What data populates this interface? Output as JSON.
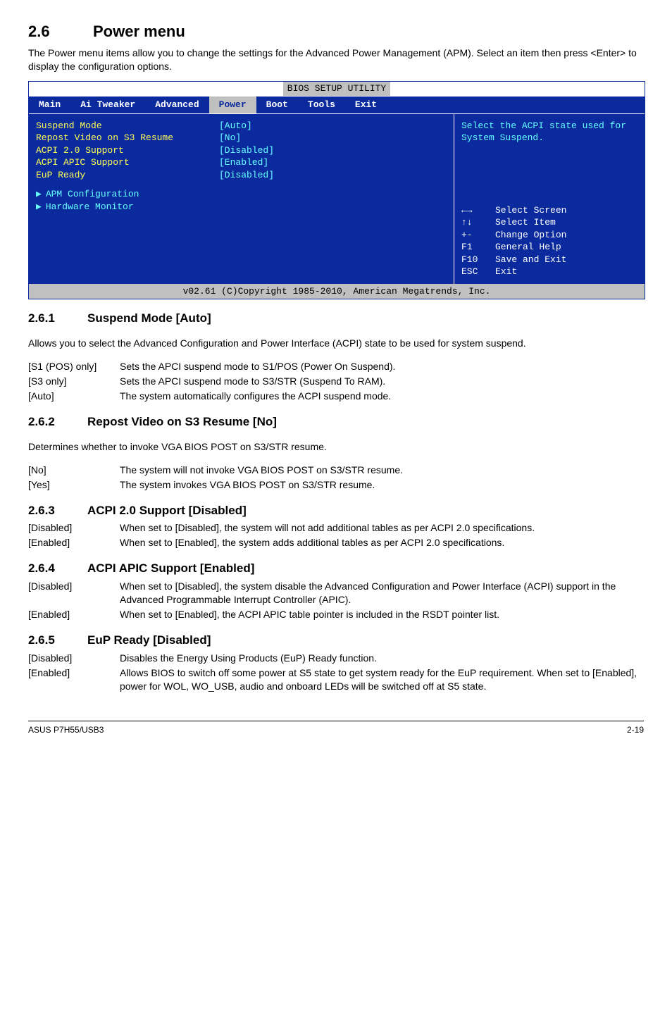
{
  "section": {
    "num": "2.6",
    "title": "Power menu"
  },
  "intro": "The Power menu items allow you to change the settings for the Advanced Power Management (APM). Select an item then press <Enter> to display the configuration options.",
  "bios": {
    "title": "BIOS SETUP UTILITY",
    "menu": [
      "Main",
      "Ai Tweaker",
      "Advanced",
      "Power",
      "Boot",
      "Tools",
      "Exit"
    ],
    "active_menu": "Power",
    "options": [
      {
        "label": "Suspend Mode",
        "value": "[Auto]"
      },
      {
        "label": "Repost Video on S3 Resume",
        "value": "[No]"
      },
      {
        "label": "ACPI 2.0 Support",
        "value": "[Disabled]"
      },
      {
        "label": "ACPI APIC Support",
        "value": "[Enabled]"
      },
      {
        "label": "EuP Ready",
        "value": "[Disabled]"
      }
    ],
    "subs": [
      "APM Configuration",
      "Hardware Monitor"
    ],
    "help": "Select the ACPI state used for System Suspend.",
    "keys": [
      {
        "k": "←→",
        "v": "Select Screen"
      },
      {
        "k": "↑↓",
        "v": "Select Item"
      },
      {
        "k": "+-",
        "v": "Change Option"
      },
      {
        "k": "F1",
        "v": "General Help"
      },
      {
        "k": "F10",
        "v": "Save and Exit"
      },
      {
        "k": "ESC",
        "v": "Exit"
      }
    ],
    "footer": "v02.61 (C)Copyright 1985-2010, American Megatrends, Inc."
  },
  "s261": {
    "num": "2.6.1",
    "title": "Suspend Mode [Auto]",
    "desc": "Allows you to select the Advanced Configuration and Power Interface (ACPI) state to be used for system suspend.",
    "opts": [
      {
        "k": "[S1 (POS) only]",
        "v": "Sets the APCI suspend mode to S1/POS (Power On Suspend)."
      },
      {
        "k": "[S3 only]",
        "v": "Sets the APCI suspend mode to S3/STR (Suspend To RAM)."
      },
      {
        "k": "[Auto]",
        "v": "The system automatically configures the ACPI suspend mode."
      }
    ]
  },
  "s262": {
    "num": "2.6.2",
    "title": "Repost Video on S3 Resume [No]",
    "desc": "Determines whether to invoke VGA BIOS POST on S3/STR resume.",
    "opts": [
      {
        "k": "[No]",
        "v": "The system will not invoke VGA BIOS POST on S3/STR resume."
      },
      {
        "k": "[Yes]",
        "v": "The system invokes VGA BIOS POST on S3/STR resume."
      }
    ]
  },
  "s263": {
    "num": "2.6.3",
    "title": "ACPI 2.0 Support [Disabled]",
    "opts": [
      {
        "k": "[Disabled]",
        "v": "When set to [Disabled], the system will not add additional tables as per ACPI 2.0 specifications."
      },
      {
        "k": "[Enabled]",
        "v": "When set to [Enabled], the system adds additional tables as per ACPI 2.0 specifications."
      }
    ]
  },
  "s264": {
    "num": "2.6.4",
    "title": "ACPI APIC Support [Enabled]",
    "opts": [
      {
        "k": "[Disabled]",
        "v": "When set to [Disabled], the system disable the Advanced Configuration and Power Interface (ACPI) support in the Advanced Programmable Interrupt Controller (APIC)."
      },
      {
        "k": "[Enabled]",
        "v": "When set to [Enabled], the ACPI APIC table pointer is included in the RSDT pointer list."
      }
    ]
  },
  "s265": {
    "num": "2.6.5",
    "title": "EuP Ready [Disabled]",
    "opts": [
      {
        "k": "[Disabled]",
        "v": "Disables the Energy Using Products (EuP) Ready function."
      },
      {
        "k": "[Enabled]",
        "v": "Allows BIOS to switch off some power at S5 state to get system ready for the EuP requirement. When set to [Enabled], power for WOL, WO_USB, audio and onboard LEDs will be switched off at S5 state."
      }
    ]
  },
  "footer": {
    "left": "ASUS P7H55/USB3",
    "right": "2-19"
  }
}
